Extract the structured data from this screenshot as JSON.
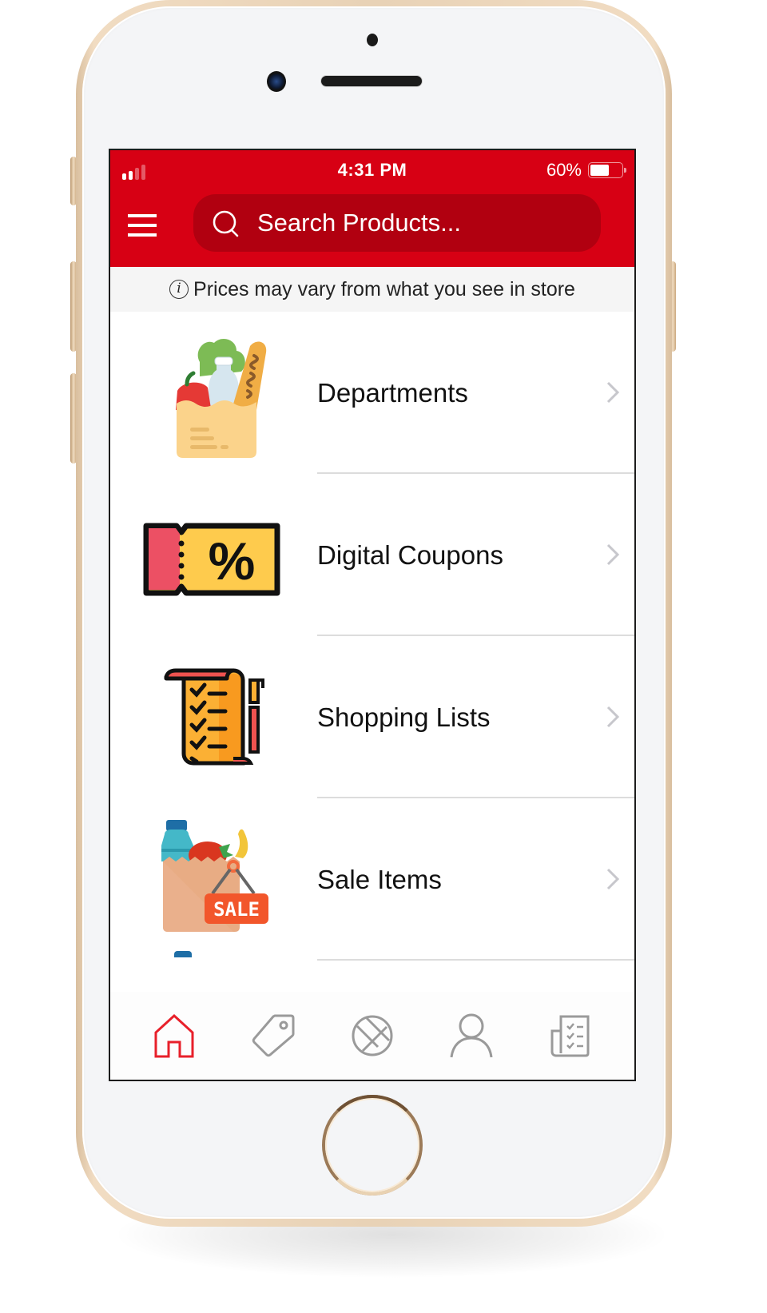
{
  "status_bar": {
    "time": "4:31 PM",
    "battery_percent_label": "60%",
    "battery_level": 0.6,
    "signal_bars_total": 4,
    "signal_bars_active": 2
  },
  "header": {
    "menu_icon": "hamburger-menu-icon",
    "search": {
      "icon": "search-icon",
      "placeholder": "Search Products..."
    }
  },
  "notice": {
    "icon": "info-icon",
    "icon_glyph": "i",
    "text": "Prices may vary from what you see in store"
  },
  "menu_items": [
    {
      "label": "Departments",
      "icon": "grocery-bag-icon"
    },
    {
      "label": "Digital Coupons",
      "icon": "coupon-icon",
      "icon_text": "%"
    },
    {
      "label": "Shopping Lists",
      "icon": "shopping-list-icon"
    },
    {
      "label": "Sale Items",
      "icon": "sale-bag-icon",
      "icon_text": "SALE"
    }
  ],
  "tab_bar": {
    "active_index": 0,
    "tabs": [
      {
        "name": "home",
        "icon": "home-icon"
      },
      {
        "name": "deals",
        "icon": "price-tag-icon"
      },
      {
        "name": "explore",
        "icon": "compass-icon"
      },
      {
        "name": "account",
        "icon": "user-icon"
      },
      {
        "name": "lists",
        "icon": "checklist-icon"
      }
    ]
  },
  "colors": {
    "brand_red": "#d70014",
    "search_bg": "#b10010",
    "active_tab": "#e8202a",
    "inactive_tab": "#9a9a9a",
    "notice_bg": "#f5f5f5"
  }
}
